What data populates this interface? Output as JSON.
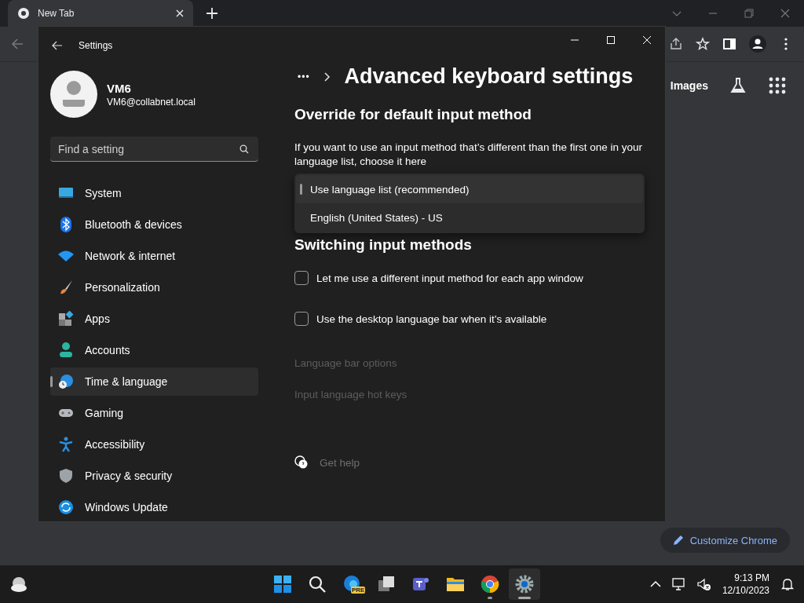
{
  "browser": {
    "tab": {
      "title": "New Tab"
    },
    "header_links": [
      {
        "label": "Images"
      }
    ],
    "customize_button": "Customize Chrome"
  },
  "settings": {
    "title": "Settings",
    "user": {
      "name": "VM6",
      "email": "VM6@collabnet.local"
    },
    "search": {
      "placeholder": "Find a setting"
    },
    "nav": [
      {
        "label": "System",
        "kind": "system",
        "selected": false
      },
      {
        "label": "Bluetooth & devices",
        "kind": "bluetooth",
        "selected": false
      },
      {
        "label": "Network & internet",
        "kind": "network",
        "selected": false
      },
      {
        "label": "Personalization",
        "kind": "brush",
        "selected": false
      },
      {
        "label": "Apps",
        "kind": "apps",
        "selected": false
      },
      {
        "label": "Accounts",
        "kind": "accounts",
        "selected": false
      },
      {
        "label": "Time & language",
        "kind": "time",
        "selected": true
      },
      {
        "label": "Gaming",
        "kind": "gaming",
        "selected": false
      },
      {
        "label": "Accessibility",
        "kind": "accessibility",
        "selected": false
      },
      {
        "label": "Privacy & security",
        "kind": "privacy",
        "selected": false
      },
      {
        "label": "Windows Update",
        "kind": "update",
        "selected": false
      }
    ],
    "breadcrumb_ellipsis": "•••",
    "page_title": "Advanced keyboard settings",
    "override": {
      "heading": "Override for default input method",
      "description": "If you want to use an input method that’s different than the first one in your language list, choose it here",
      "options": [
        {
          "label": "Use language list (recommended)",
          "selected": true
        },
        {
          "label": "English (United States) - US",
          "selected": false
        }
      ]
    },
    "switching": {
      "heading": "Switching input methods",
      "checkboxes": [
        {
          "label": "Let me use a different input method for each app window",
          "checked": false
        },
        {
          "label": "Use the desktop language bar when it’s available",
          "checked": false
        }
      ]
    },
    "links": [
      {
        "label": "Language bar options",
        "disabled": true
      },
      {
        "label": "Input language hot keys",
        "disabled": true
      }
    ],
    "help": "Get help"
  },
  "taskbar": {
    "apps": [
      {
        "kind": "start",
        "running": false,
        "active": false
      },
      {
        "kind": "search",
        "running": false,
        "active": false
      },
      {
        "kind": "edge",
        "badge": "PRE",
        "running": false,
        "active": false
      },
      {
        "kind": "taskview",
        "running": false,
        "active": false
      },
      {
        "kind": "teams",
        "running": false,
        "active": false
      },
      {
        "kind": "explorer",
        "running": false,
        "active": false
      },
      {
        "kind": "chrome",
        "running": true,
        "active": false
      },
      {
        "kind": "settings",
        "running": true,
        "active": true
      }
    ],
    "time": "9:13 PM",
    "date": "12/10/2023"
  }
}
